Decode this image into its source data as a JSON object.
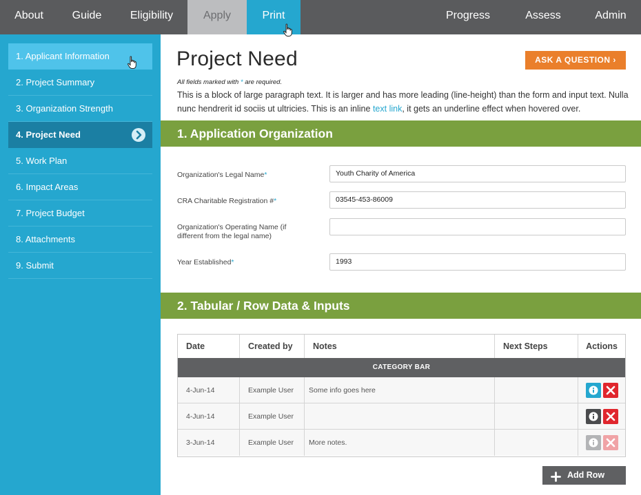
{
  "topnav": {
    "items": [
      {
        "label": "About"
      },
      {
        "label": "Guide"
      },
      {
        "label": "Eligibility"
      },
      {
        "label": "Apply"
      },
      {
        "label": "Print"
      },
      {
        "label": "Progress"
      },
      {
        "label": "Assess"
      },
      {
        "label": "Admin"
      }
    ]
  },
  "sidebar": {
    "items": [
      {
        "label": "1. Applicant Information"
      },
      {
        "label": "2. Project Summary"
      },
      {
        "label": "3. Organization Strength"
      },
      {
        "label": "4. Project Need"
      },
      {
        "label": "5. Work Plan"
      },
      {
        "label": "6. Impact Areas"
      },
      {
        "label": "7. Project Budget"
      },
      {
        "label": "8. Attachments"
      },
      {
        "label": "9. Submit"
      }
    ],
    "active_icon": "chevron-right-circle-icon"
  },
  "main": {
    "title": "Project Need",
    "ask_button": "ASK A QUESTION ›",
    "required_note_prefix": "All fields marked with",
    "required_note_star": "*",
    "required_note_suffix": "are required.",
    "intro_before": "This is a block of large paragraph text. It is larger and has more leading (line-height) than the form and input text. Nulla nunc hendrerit id sociis ut ultricies. This is an inline",
    "intro_link": "text link",
    "intro_after": ", it gets an underline effect when hovered over."
  },
  "section1": {
    "title": "1. Application Organization",
    "fields": [
      {
        "label": "Organization's Legal Name",
        "required": "*",
        "value": "Youth Charity of America"
      },
      {
        "label": "CRA Charitable Registration #",
        "required": "*",
        "value": "03545-453-86009"
      },
      {
        "label": "Organization's Operating Name  (if different from the legal name)",
        "required": "",
        "value": ""
      },
      {
        "label": "Year Established",
        "required": "*",
        "value": "1993"
      }
    ]
  },
  "section2": {
    "title": "2. Tabular / Row Data & Inputs",
    "columns": [
      "Date",
      "Created by",
      "Notes",
      "Next Steps",
      "Actions"
    ],
    "category_bar": "CATEGORY BAR",
    "rows": [
      {
        "date": "4-Jun-14",
        "created_by": "Example User",
        "notes": "Some info goes here",
        "next_steps": "",
        "info_state": "active"
      },
      {
        "date": "4-Jun-14",
        "created_by": "Example User",
        "notes": "",
        "next_steps": "",
        "info_state": "dark"
      },
      {
        "date": "3-Jun-14",
        "created_by": "Example User",
        "notes": "More notes.",
        "next_steps": "",
        "info_state": "disabled"
      }
    ],
    "add_row_label": "Add Row"
  },
  "colors": {
    "nav_bg": "#5a5b5d",
    "accent_blue": "#25a7cf",
    "sidebar_active": "#1b7fa3",
    "section_green": "#7aa03f",
    "ask_orange": "#ea7f2b",
    "delete_red": "#e0262d",
    "dark_grey": "#5f6062"
  }
}
